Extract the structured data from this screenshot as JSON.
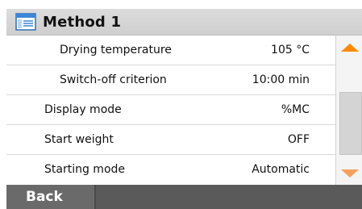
{
  "header": {
    "title": "Method 1",
    "icon": "method-window-icon"
  },
  "list": {
    "rows": [
      {
        "label": "Drying temperature",
        "value": "105 °C"
      },
      {
        "label": "Switch-off criterion",
        "value": "10:00 min"
      },
      {
        "label": "Display mode",
        "value": "%MC"
      },
      {
        "label": "Start weight",
        "value": "OFF"
      },
      {
        "label": "Starting mode",
        "value": "Automatic"
      }
    ]
  },
  "scrollbar": {
    "up_icon": "scroll-up-arrow-icon",
    "down_icon": "scroll-down-arrow-icon",
    "accent_color": "#ff8a00"
  },
  "footer": {
    "back_label": "Back"
  }
}
